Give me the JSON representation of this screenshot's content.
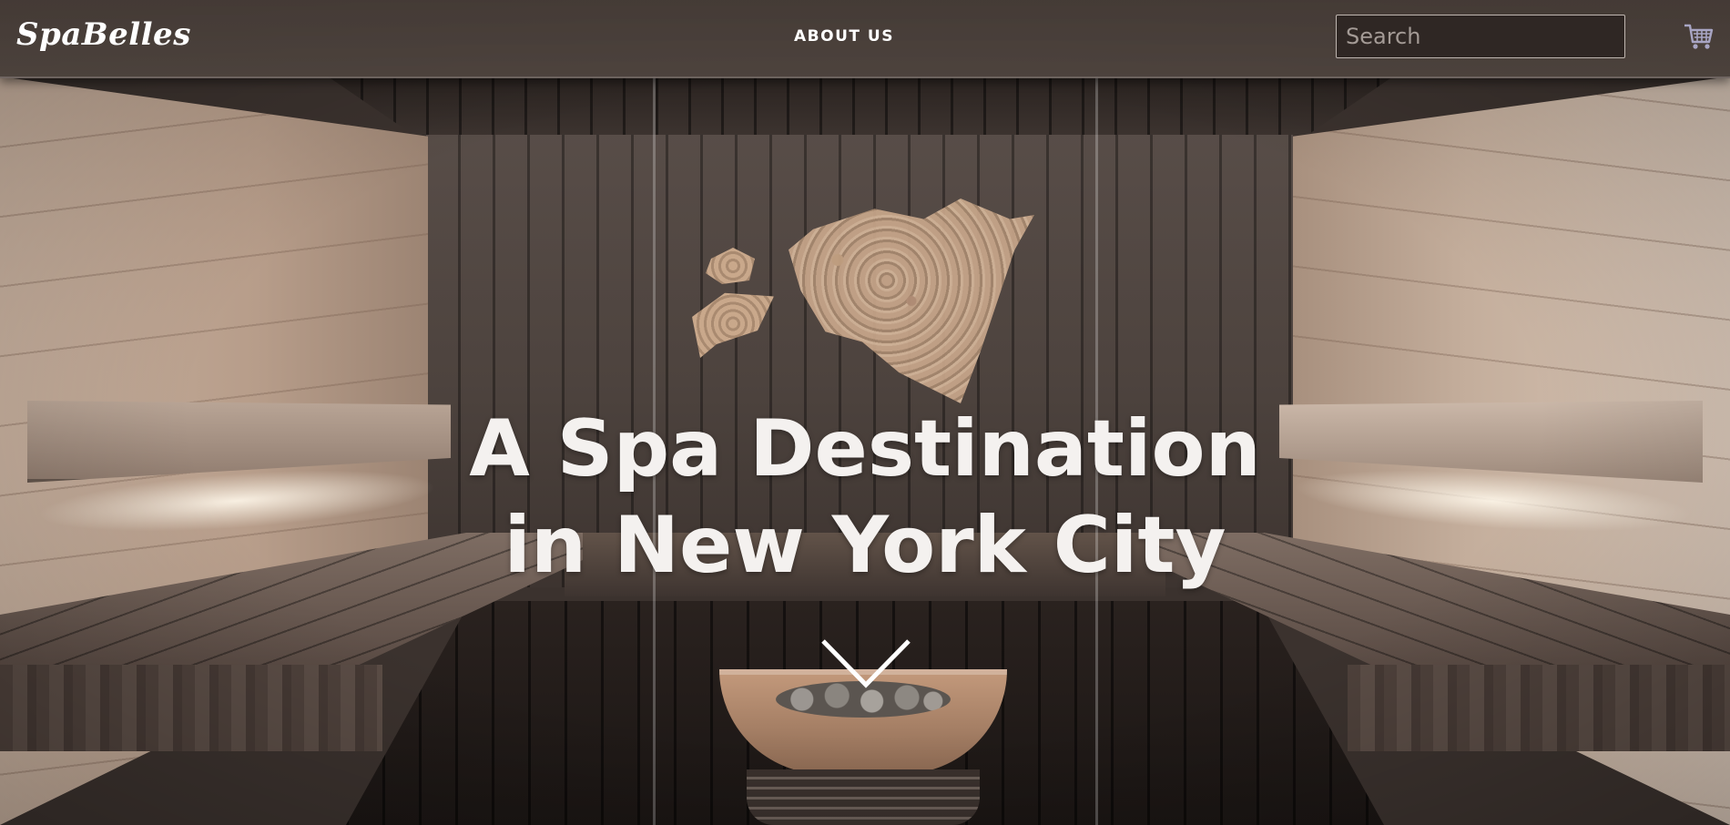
{
  "header": {
    "logo": "SpaBelles",
    "nav": {
      "about_label": "ABOUT US"
    },
    "search": {
      "placeholder": "Search",
      "value": ""
    },
    "cart_icon": "shopping-cart-icon"
  },
  "hero": {
    "title_line1": "A Spa Destination",
    "title_line2": "in New York City",
    "scroll_icon": "chevron-down-icon",
    "background": "sauna-interior-photo"
  },
  "colors": {
    "header_bg": "#4a403b",
    "text": "#ffffff",
    "search_bg": "#2f2724",
    "search_border": "#bfb6b0",
    "cart_icon": "#a8a5c4"
  }
}
